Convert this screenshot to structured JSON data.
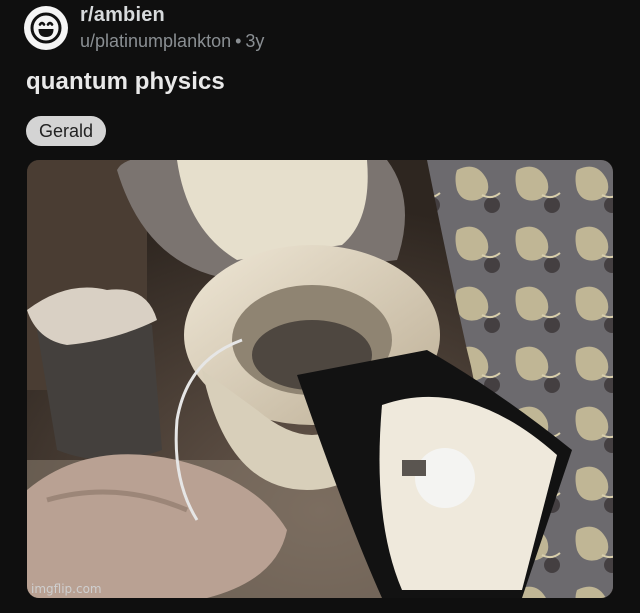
{
  "post": {
    "subreddit": "r/ambien",
    "author": "u/platinumplankton",
    "separator": "•",
    "age": "3y",
    "title": "quantum physics",
    "flair": "Gerald"
  },
  "avatar": {
    "icon": "smiley-face-icon"
  },
  "media": {
    "subject": "photo-toilet-with-lamp"
  },
  "watermark": {
    "text": "imgflip.com"
  },
  "colors": {
    "background": "#0f0f0f",
    "flair_bg": "#d4d4d4",
    "secondary_text": "#8a8f93"
  }
}
